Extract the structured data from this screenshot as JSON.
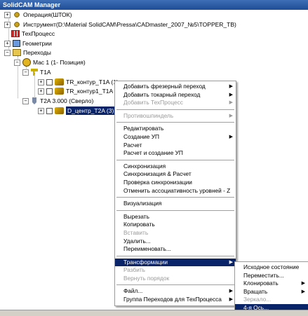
{
  "window": {
    "title": "SolidCAM Manager"
  },
  "tree": {
    "operation": "Операция(ШТОК)",
    "tool": "Инструмент(D:\\Material SolidCAM\\Pressa\\CADmaster_2007_№5\\TOPPER_TB)",
    "process": "ТехПроцесс",
    "geometry": "Геометрии",
    "transitions": "Переходы",
    "mac": "Mac 1 (1- Позиция)",
    "t1a": "T1A",
    "op1": "TR_контур_T1A (1)",
    "op2": "TR_контур1_T1A (1)",
    "t2a": "T2A 3.000 (Сверло)",
    "op3": "D_центр_T2A (3)"
  },
  "context_menu": {
    "groups": [
      [
        {
          "label": "Добавить фрезерный переход",
          "submenu": true,
          "disabled": false
        },
        {
          "label": "Добавить токарный переход",
          "submenu": true,
          "disabled": false
        },
        {
          "label": "Добавить ТехПроцесс",
          "submenu": true,
          "disabled": true
        }
      ],
      [
        {
          "label": "Противошпиндель",
          "submenu": true,
          "disabled": true
        }
      ],
      [
        {
          "label": "Редактировать",
          "submenu": false,
          "disabled": false
        },
        {
          "label": "Создание УП",
          "submenu": true,
          "disabled": false
        },
        {
          "label": "Расчет",
          "submenu": false,
          "disabled": false
        },
        {
          "label": "Расчет и создание УП",
          "submenu": false,
          "disabled": false
        }
      ],
      [
        {
          "label": "Синхронизация",
          "submenu": false,
          "disabled": false
        },
        {
          "label": "Синхронизация & Расчет",
          "submenu": false,
          "disabled": false
        },
        {
          "label": "Проверка синхронизации",
          "submenu": false,
          "disabled": false
        },
        {
          "label": "Отменить ассоциативность уровней - Z",
          "submenu": false,
          "disabled": false
        }
      ],
      [
        {
          "label": "Визуализация",
          "submenu": false,
          "disabled": false
        }
      ],
      [
        {
          "label": "Вырезать",
          "submenu": false,
          "disabled": false
        },
        {
          "label": "Копировать",
          "submenu": false,
          "disabled": false
        },
        {
          "label": "Вставить",
          "submenu": false,
          "disabled": true
        },
        {
          "label": "Удалить...",
          "submenu": false,
          "disabled": false
        },
        {
          "label": "Переименовать...",
          "submenu": false,
          "disabled": false
        }
      ],
      [
        {
          "label": "Трансформации",
          "submenu": true,
          "disabled": false,
          "highlighted": true
        },
        {
          "label": "Разбить",
          "submenu": false,
          "disabled": true
        },
        {
          "label": "Вернуть порядок",
          "submenu": false,
          "disabled": true
        }
      ],
      [
        {
          "label": "Файл...",
          "submenu": true,
          "disabled": false
        },
        {
          "label": "Группа Переходов для ТехПроцесса",
          "submenu": true,
          "disabled": false
        }
      ]
    ]
  },
  "submenu": {
    "items": [
      {
        "label": "Исходное состояние",
        "submenu": false,
        "disabled": false
      },
      {
        "label": "Переместить...",
        "submenu": false,
        "disabled": false
      },
      {
        "label": "Клонировать",
        "submenu": true,
        "disabled": false
      },
      {
        "label": "Вращать",
        "submenu": true,
        "disabled": false
      },
      {
        "label": "Зеркало...",
        "submenu": false,
        "disabled": true
      },
      {
        "label": "4-я Ось...",
        "submenu": false,
        "disabled": false,
        "highlighted": true
      }
    ]
  },
  "colors": {
    "highlight": "#0a246a",
    "titlebar": "#2a5aa6",
    "disabled": "#9a9a9a"
  }
}
